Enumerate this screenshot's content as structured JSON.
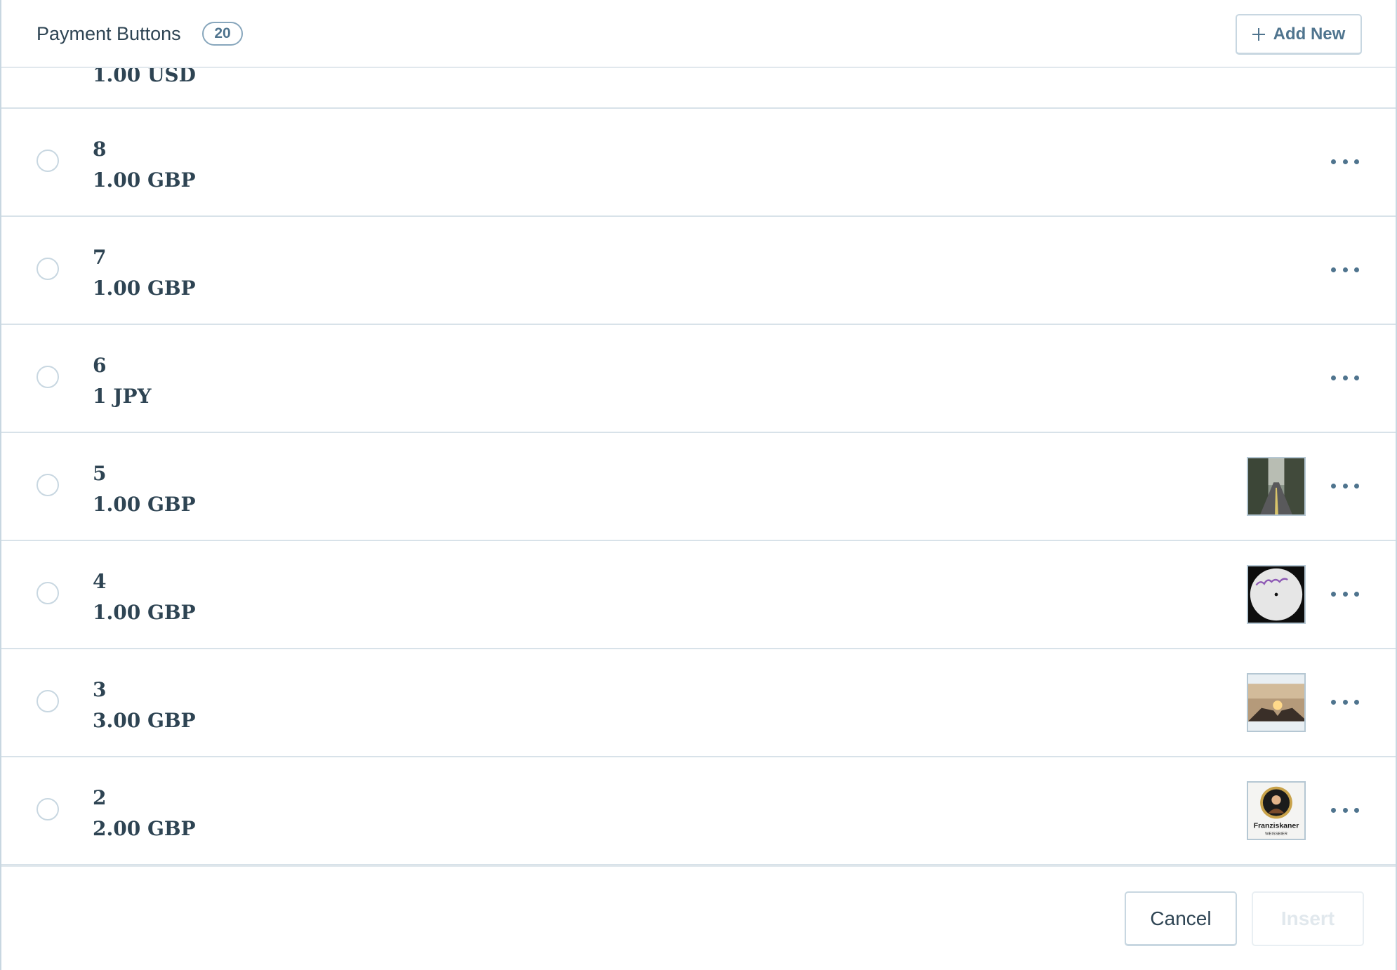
{
  "header": {
    "title": "Payment Buttons",
    "count": "20",
    "add_new_label": "Add New"
  },
  "rows": [
    {
      "title": "",
      "price": "1.00 USD",
      "image": "",
      "partial": true
    },
    {
      "title": "8",
      "price": "1.00 GBP",
      "image": ""
    },
    {
      "title": "7",
      "price": "1.00 GBP",
      "image": ""
    },
    {
      "title": "6",
      "price": "1 JPY",
      "image": ""
    },
    {
      "title": "5",
      "price": "1.00 GBP",
      "image": "forest-road-photo"
    },
    {
      "title": "4",
      "price": "1.00 GBP",
      "image": "vinyl-record-photo"
    },
    {
      "title": "3",
      "price": "3.00 GBP",
      "image": "sunset-hands-photo"
    },
    {
      "title": "2",
      "price": "2.00 GBP",
      "image": "franziskaner-logo",
      "image_text": [
        "Franziskaner",
        "WEISSBIER"
      ]
    }
  ],
  "footer": {
    "cancel_label": "Cancel",
    "insert_label": "Insert"
  },
  "colors": {
    "text": "#2e4453",
    "muted": "#4f748e",
    "border": "#c8d7e1",
    "disabled": "#e1e8ed"
  }
}
